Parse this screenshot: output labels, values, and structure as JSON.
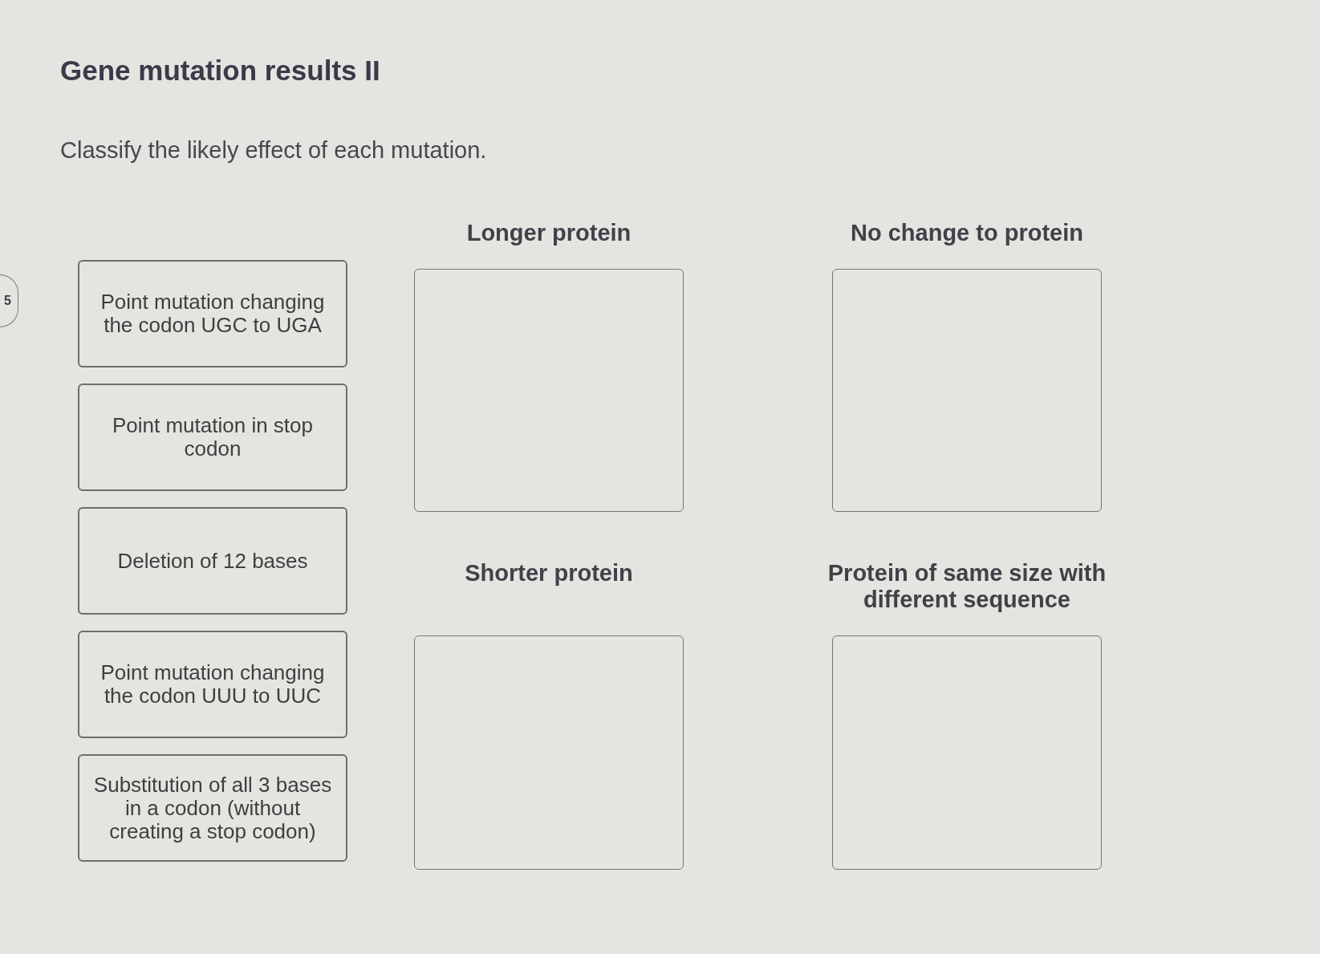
{
  "question_number": "5",
  "title": "Gene mutation results II",
  "instructions": "Classify the likely effect of each mutation.",
  "items": [
    {
      "label": "Point mutation changing the codon UGC to UGA"
    },
    {
      "label": "Point mutation in stop codon"
    },
    {
      "label": "Deletion of 12 bases"
    },
    {
      "label": "Point mutation changing the codon UUU to UUC"
    },
    {
      "label": "Substitution of all 3 bases in a codon (without creating a stop codon)"
    }
  ],
  "bins": [
    {
      "label": "Longer protein"
    },
    {
      "label": "No change to protein"
    },
    {
      "label": "Shorter protein"
    },
    {
      "label": "Protein of same size with different sequence"
    }
  ]
}
